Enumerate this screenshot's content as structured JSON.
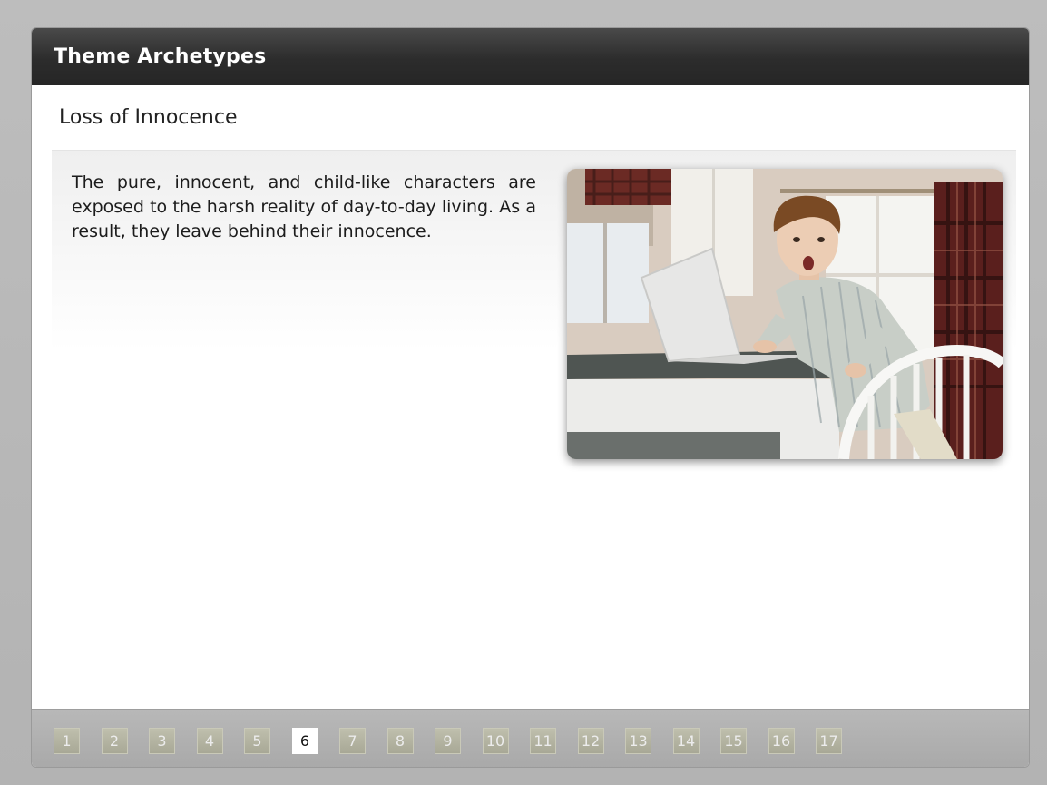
{
  "header": {
    "title": "Theme Archetypes"
  },
  "slide": {
    "heading": "Loss of Innocence",
    "body": "The pure, innocent, and child-like characters are exposed to the harsh reality of day-to-day living.  As a result, they leave behind their innocence.",
    "image": {
      "depicts": "boy-with-laptop-photo"
    }
  },
  "pager": {
    "current": "6",
    "pages": [
      "1",
      "2",
      "3",
      "4",
      "5",
      "6",
      "7",
      "8",
      "9",
      "10",
      "11",
      "12",
      "13",
      "14",
      "15",
      "16",
      "17"
    ]
  },
  "colors": {
    "titlebar": "#2c2c2c",
    "active_page_bg": "#ffffff",
    "inactive_page_bg": "#b4b4a2"
  }
}
